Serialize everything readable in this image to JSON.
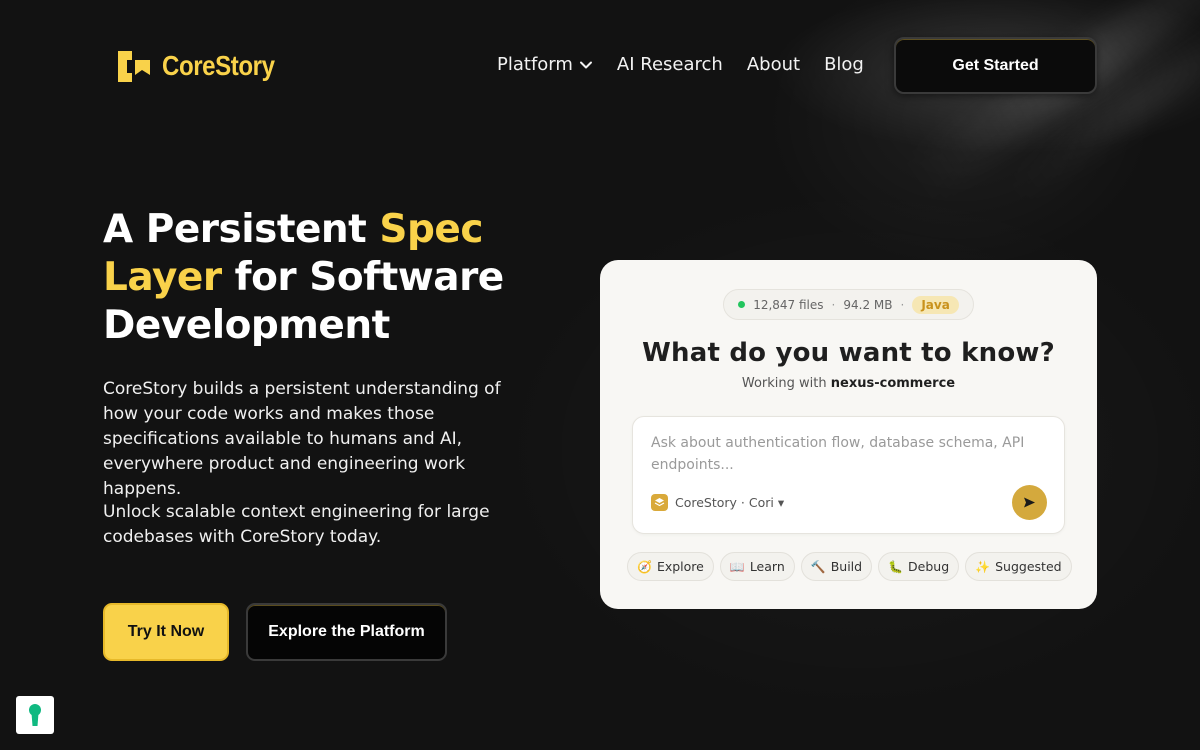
{
  "brand": {
    "name": "CoreStory",
    "accent_color": "#f9d24a"
  },
  "nav": {
    "items": [
      {
        "label": "Platform",
        "has_dropdown": true,
        "icon": "chevron-down-icon"
      },
      {
        "label": "AI Research"
      },
      {
        "label": "About"
      },
      {
        "label": "Blog"
      }
    ],
    "cta_label": "Get Started"
  },
  "hero": {
    "title_prefix": "A Persistent ",
    "title_accent": "Spec Layer",
    "title_suffix": " for Software Development",
    "description": "CoreStory builds a persistent understanding of how your code works and makes those specifications available to humans and AI, everywhere product and engineering work happens.",
    "description2": "Unlock scalable context engineering for large codebases with CoreStory today.",
    "primary_cta": "Try It Now",
    "secondary_cta": "Explore the Platform"
  },
  "card": {
    "stats": {
      "files": "12,847 files",
      "sep": "·",
      "size": "94.2 MB",
      "language": "Java",
      "status_color": "#22c55e"
    },
    "title": "What do you want to know?",
    "subtitle_prefix": "Working with",
    "project": "nexus-commerce",
    "input_placeholder": "Ask about authentication flow, database schema, API endpoints...",
    "model_label": "CoreStory · Cori ▾",
    "send_icon": "send-icon",
    "chips": [
      {
        "icon": "🧭",
        "label": "Explore"
      },
      {
        "icon": "📖",
        "label": "Learn"
      },
      {
        "icon": "🔨",
        "label": "Build"
      },
      {
        "icon": "🐛",
        "label": "Debug"
      },
      {
        "icon": "✨",
        "label": "Suggested"
      }
    ]
  },
  "floating": {
    "icon": "keyhole-icon",
    "color": "#10b981"
  }
}
